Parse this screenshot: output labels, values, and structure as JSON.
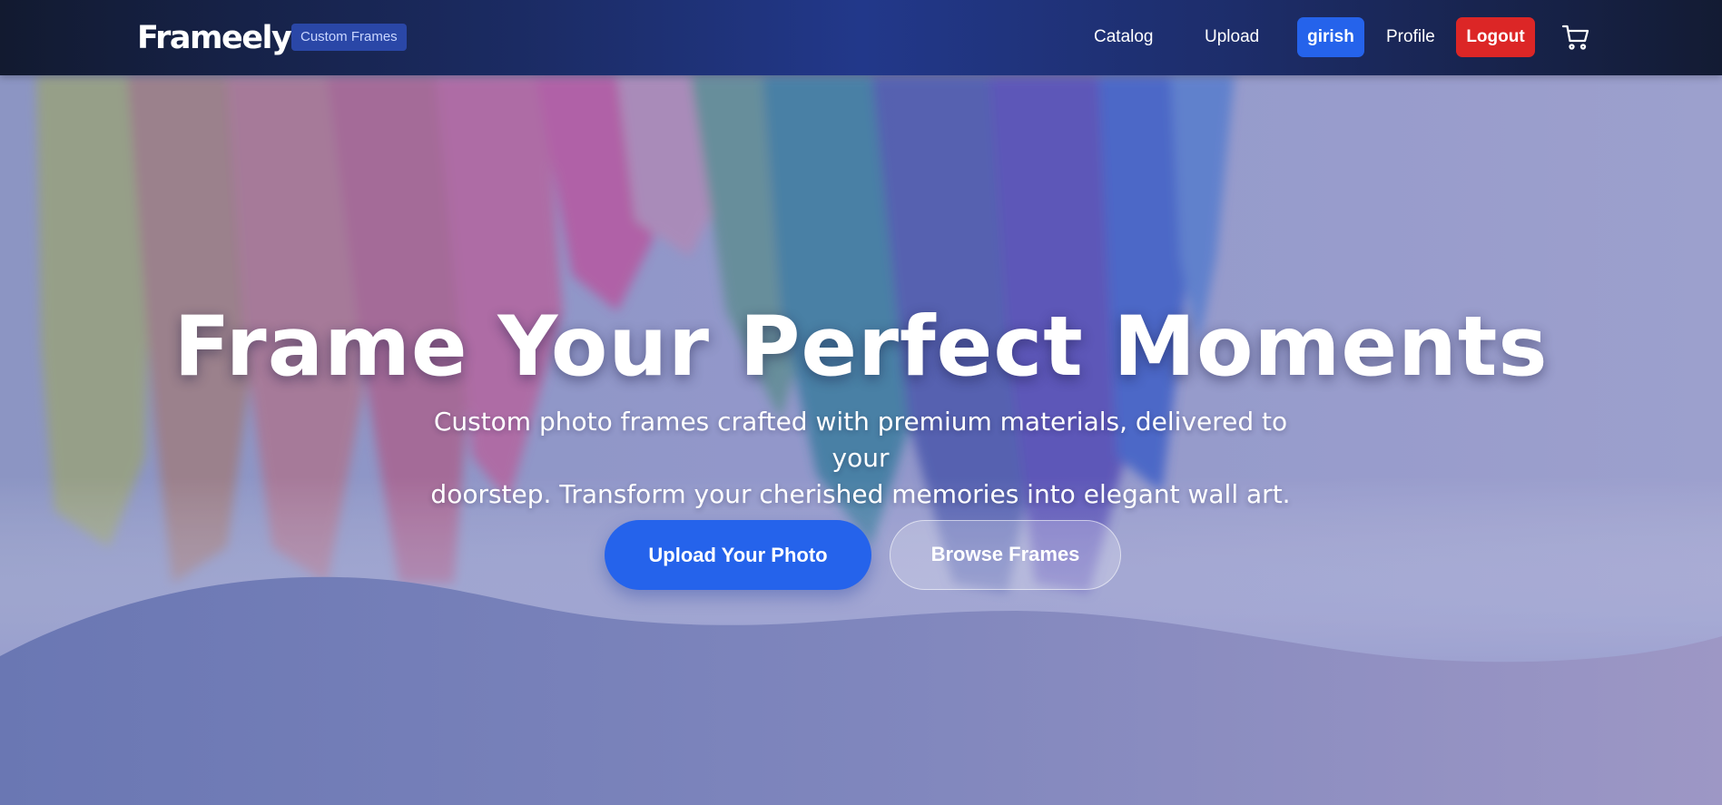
{
  "header": {
    "brand": "Frameely",
    "badge": "Custom Frames",
    "nav": {
      "catalog": "Catalog",
      "upload": "Upload",
      "user": "girish",
      "profile": "Profile",
      "logout": "Logout"
    },
    "cart_icon": "shopping-cart-icon"
  },
  "hero": {
    "title": "Frame Your Perfect Moments",
    "subtitle_line1": "Custom photo frames crafted with premium materials, delivered to your",
    "subtitle_line2": "doorstep. Transform your cherished memories into elegant wall art.",
    "primary_button": "Upload Your Photo",
    "secondary_button": "Browse Frames"
  },
  "colors": {
    "accent": "#2563eb",
    "danger": "#dc2626",
    "nav_dark": "#131b33"
  }
}
